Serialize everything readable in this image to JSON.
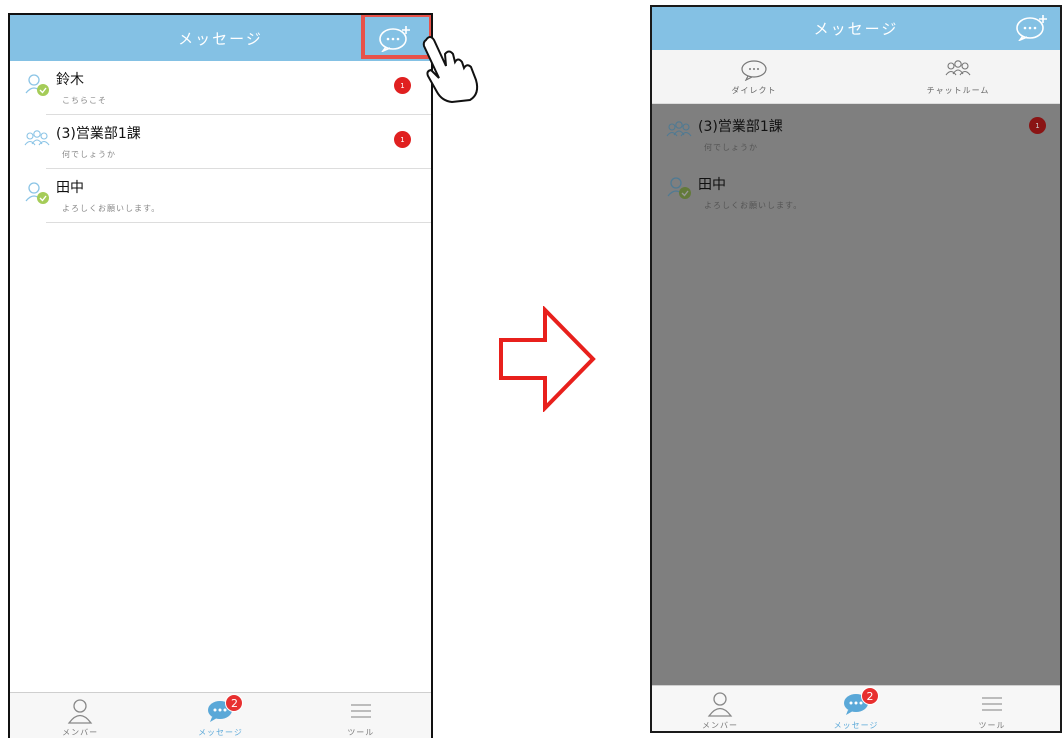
{
  "left_screen": {
    "header": {
      "title": "メッセージ"
    },
    "conversations": [
      {
        "name": "鈴木",
        "preview": "こちらこそ",
        "type": "direct",
        "unread": "1"
      },
      {
        "name": "(3)営業部1課",
        "preview": "何でしょうか",
        "type": "group",
        "unread": "1"
      },
      {
        "name": "田中",
        "preview": "よろしくお願いします。",
        "type": "direct",
        "unread": ""
      }
    ],
    "tabbar": [
      {
        "label": "メンバー",
        "icon": "person-icon",
        "badge": ""
      },
      {
        "label": "メッセージ",
        "icon": "chat-bubble-icon",
        "badge": "2"
      },
      {
        "label": "ツール",
        "icon": "hamburger-menu-icon",
        "badge": ""
      }
    ]
  },
  "right_screen": {
    "header": {
      "title": "メッセージ"
    },
    "submenu": [
      {
        "label": "ダイレクト",
        "icon": "speech-bubble-icon"
      },
      {
        "label": "チャットルーム",
        "icon": "group-icon"
      }
    ],
    "conversations": [
      {
        "name": "(3)営業部1課",
        "preview": "何でしょうか",
        "type": "group",
        "unread": "1"
      },
      {
        "name": "田中",
        "preview": "よろしくお願いします。",
        "type": "direct",
        "unread": ""
      }
    ],
    "tabbar": [
      {
        "label": "メンバー",
        "icon": "person-icon",
        "badge": ""
      },
      {
        "label": "メッセージ",
        "icon": "chat-bubble-icon",
        "badge": "2"
      },
      {
        "label": "ツール",
        "icon": "hamburger-menu-icon",
        "badge": ""
      }
    ]
  },
  "colors": {
    "header": "#84c1e4",
    "highlight": "#e8524a",
    "badge": "#e02020",
    "arrow": "#e8201c",
    "overlay": "#7f7f7f"
  }
}
